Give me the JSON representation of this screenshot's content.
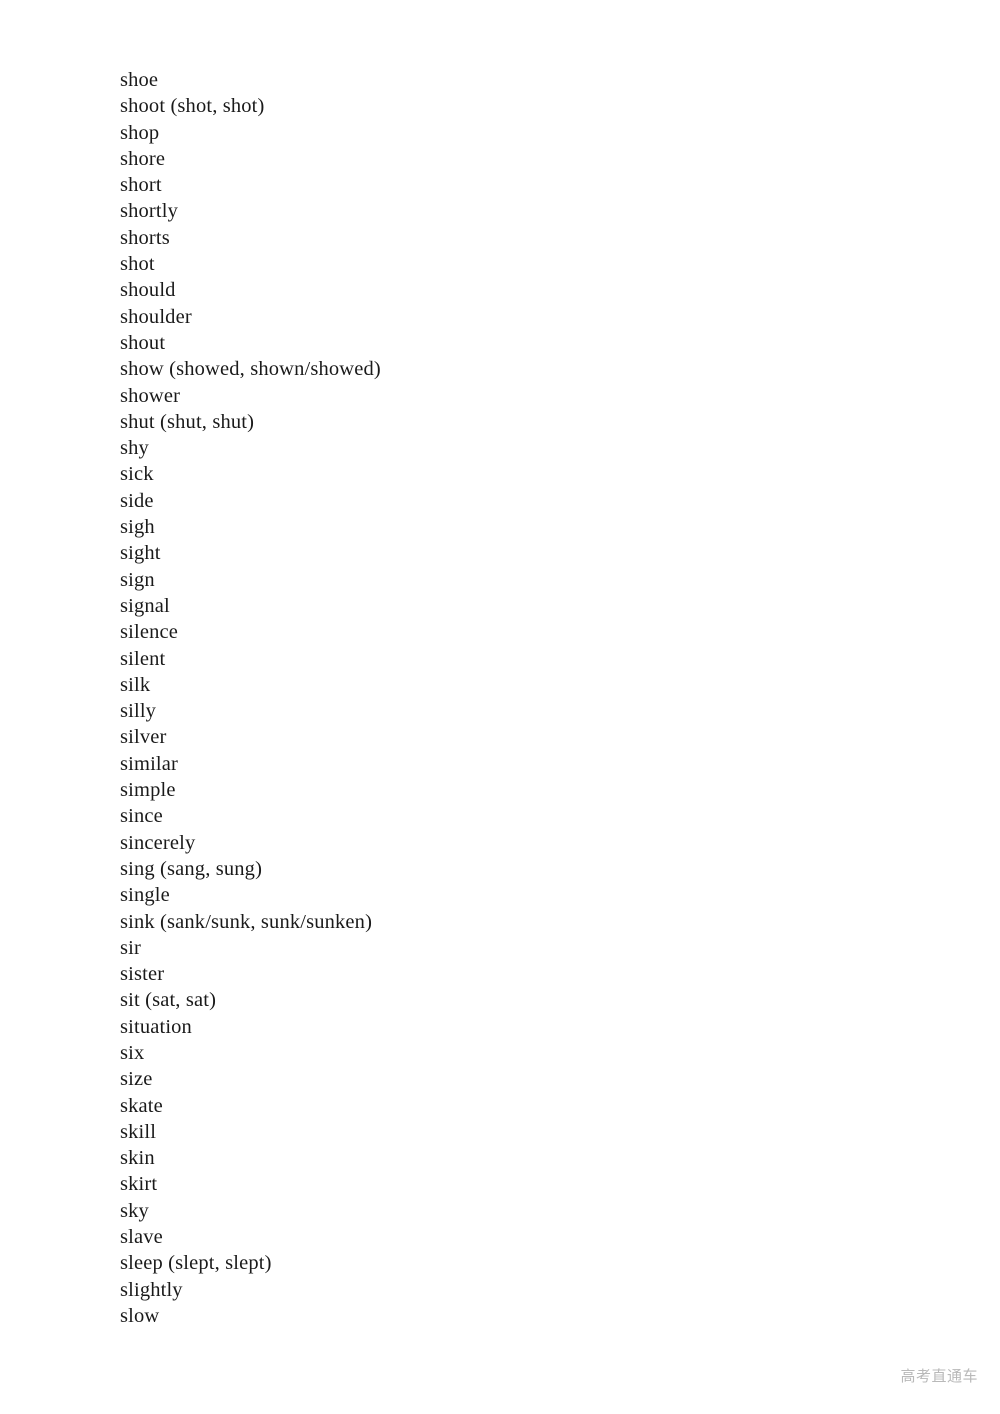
{
  "document": {
    "background_color": "#ffffff",
    "text_color": "#1a1a1a",
    "word_entries": [
      "shoe",
      "shoot (shot, shot)",
      "shop",
      "shore",
      "short",
      "shortly",
      "shorts",
      "shot",
      "should",
      "shoulder",
      "shout",
      "show (showed, shown/showed)",
      "shower",
      "shut (shut, shut)",
      "shy",
      "sick",
      "side",
      "sigh",
      "sight",
      "sign",
      "signal",
      "silence",
      "silent",
      "silk",
      "silly",
      "silver",
      "similar",
      "simple",
      "since",
      "sincerely",
      "sing (sang, sung)",
      "single",
      "sink (sank/sunk, sunk/sunken)",
      "sir",
      "sister",
      "sit (sat, sat)",
      "situation",
      "six",
      "size",
      "skate",
      "skill",
      "skin",
      "skirt",
      "sky",
      "slave",
      "sleep (slept, slept)",
      "slightly",
      "slow"
    ]
  },
  "watermark": {
    "text": "高考直通车",
    "color": "#b9b9b9"
  }
}
